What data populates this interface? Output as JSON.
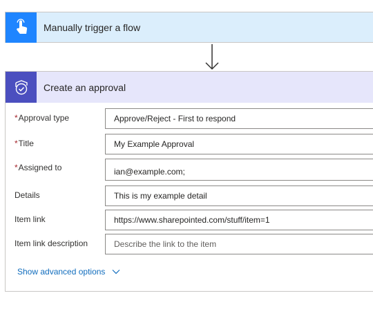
{
  "trigger": {
    "title": "Manually trigger a flow",
    "icon": "touch-hand-icon",
    "color": "#1f85ff",
    "header_bg": "#dbeefc"
  },
  "approval": {
    "title": "Create an approval",
    "icon": "approval-check-icon",
    "color": "#4b4fbf",
    "header_bg": "#e6e6fb",
    "fields": [
      {
        "label": "Approval type",
        "required": true,
        "value": "Approve/Reject - First to respond",
        "placeholder": ""
      },
      {
        "label": "Title",
        "required": true,
        "value": "My Example Approval",
        "placeholder": ""
      },
      {
        "label": "Assigned to",
        "required": true,
        "value": "ian@example.com;",
        "placeholder": ""
      },
      {
        "label": "Details",
        "required": false,
        "value": "This is my example detail",
        "placeholder": ""
      },
      {
        "label": "Item link",
        "required": false,
        "value": "https://www.sharepointed.com/stuff/item=1",
        "placeholder": ""
      },
      {
        "label": "Item link description",
        "required": false,
        "value": "",
        "placeholder": "Describe the link to the item"
      }
    ],
    "required_marker": "*",
    "advanced_options_label": "Show advanced options"
  }
}
